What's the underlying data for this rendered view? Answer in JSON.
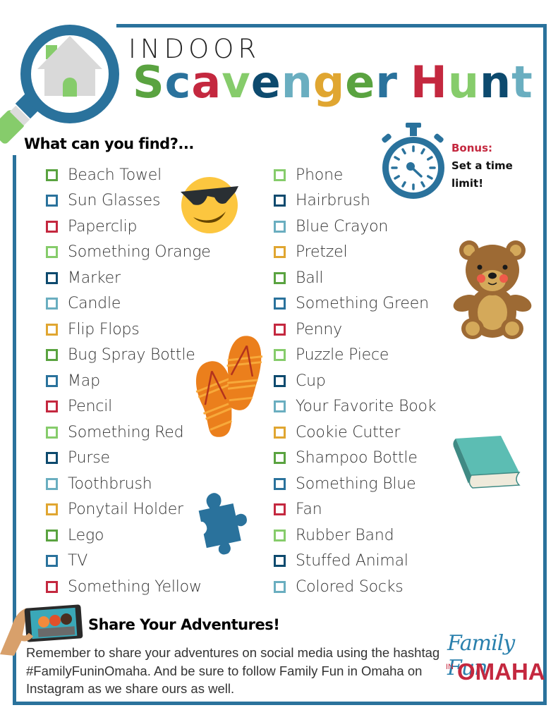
{
  "header": {
    "title_line1": "INDOOR",
    "title_line2_letters": [
      {
        "char": "S",
        "color": "#5aa340"
      },
      {
        "char": "c",
        "color": "#2a729c"
      },
      {
        "char": "a",
        "color": "#c4283f"
      },
      {
        "char": "v",
        "color": "#86cc6b"
      },
      {
        "char": "e",
        "color": "#0d4a6e"
      },
      {
        "char": "n",
        "color": "#6aaec0"
      },
      {
        "char": "g",
        "color": "#e0a631"
      },
      {
        "char": "e",
        "color": "#5aa340"
      },
      {
        "char": "r",
        "color": "#2a729c"
      },
      {
        "char": " ",
        "color": "#000000"
      },
      {
        "char": "H",
        "color": "#c4283f"
      },
      {
        "char": "u",
        "color": "#86cc6b"
      },
      {
        "char": "n",
        "color": "#0d4a6e"
      },
      {
        "char": "t",
        "color": "#6aaec0"
      }
    ],
    "subtitle": "What can you find?..."
  },
  "bonus": {
    "label": "Bonus:",
    "text_line1": "Set a time",
    "text_line2": "limit!"
  },
  "colors": {
    "frame": "#2a729c",
    "green": "#5aa340",
    "blue": "#2a729c",
    "red": "#c4283f",
    "light_green": "#86cc6b",
    "navy": "#0d4a6e",
    "light_blue": "#6aaec0",
    "orange": "#e0a631"
  },
  "checklist": {
    "left": [
      {
        "label": "Beach Towel",
        "color": "#5aa340",
        "checked": false
      },
      {
        "label": "Sun Glasses",
        "color": "#2a729c",
        "checked": false
      },
      {
        "label": "Paperclip",
        "color": "#c4283f",
        "checked": false
      },
      {
        "label": "Something Orange",
        "color": "#86cc6b",
        "checked": false
      },
      {
        "label": "Marker",
        "color": "#0d4a6e",
        "checked": false
      },
      {
        "label": "Candle",
        "color": "#6aaec0",
        "checked": false
      },
      {
        "label": "Flip Flops",
        "color": "#e0a631",
        "checked": false
      },
      {
        "label": "Bug Spray Bottle",
        "color": "#5aa340",
        "checked": false
      },
      {
        "label": "Map",
        "color": "#2a729c",
        "checked": false
      },
      {
        "label": "Pencil",
        "color": "#c4283f",
        "checked": false
      },
      {
        "label": "Something Red",
        "color": "#86cc6b",
        "checked": false
      },
      {
        "label": "Purse",
        "color": "#0d4a6e",
        "checked": false
      },
      {
        "label": "Toothbrush",
        "color": "#6aaec0",
        "checked": false
      },
      {
        "label": "Ponytail Holder",
        "color": "#e0a631",
        "checked": false
      },
      {
        "label": "Lego",
        "color": "#5aa340",
        "checked": false
      },
      {
        "label": "TV",
        "color": "#2a729c",
        "checked": false
      },
      {
        "label": "Something Yellow",
        "color": "#c4283f",
        "checked": false
      }
    ],
    "right": [
      {
        "label": "Phone",
        "color": "#86cc6b",
        "checked": false
      },
      {
        "label": "Hairbrush",
        "color": "#0d4a6e",
        "checked": false
      },
      {
        "label": "Blue Crayon",
        "color": "#6aaec0",
        "checked": false
      },
      {
        "label": "Pretzel",
        "color": "#e0a631",
        "checked": false
      },
      {
        "label": "Ball",
        "color": "#5aa340",
        "checked": false
      },
      {
        "label": "Something Green",
        "color": "#2a729c",
        "checked": false
      },
      {
        "label": "Penny",
        "color": "#c4283f",
        "checked": false
      },
      {
        "label": "Puzzle Piece",
        "color": "#86cc6b",
        "checked": false
      },
      {
        "label": "Cup",
        "color": "#0d4a6e",
        "checked": false
      },
      {
        "label": "Your Favorite Book",
        "color": "#6aaec0",
        "checked": false
      },
      {
        "label": "Cookie Cutter",
        "color": "#e0a631",
        "checked": false
      },
      {
        "label": "Shampoo Bottle",
        "color": "#5aa340",
        "checked": false
      },
      {
        "label": "Something Blue",
        "color": "#2a729c",
        "checked": false
      },
      {
        "label": "Fan",
        "color": "#c4283f",
        "checked": false
      },
      {
        "label": "Rubber Band",
        "color": "#86cc6b",
        "checked": false
      },
      {
        "label": "Stuffed Animal",
        "color": "#0d4a6e",
        "checked": false
      },
      {
        "label": "Colored Socks",
        "color": "#6aaec0",
        "checked": false
      }
    ]
  },
  "illustrations": {
    "magnifier": "magnifying-glass-house-icon",
    "stopwatch": "stopwatch-icon",
    "sunglasses": "sunglasses-emoji-icon",
    "teddy": "teddy-bear-icon",
    "flipflops": "flip-flops-icon",
    "book": "book-icon",
    "puzzle": "puzzle-piece-icon",
    "selfie": "selfie-phone-icon"
  },
  "share": {
    "title": "Share Your Adventures!",
    "body": "Remember to share your adventures on social media using the hashtag #FamilyFuninOmaha. And be sure to follow Family Fun in Omaha on Instagram as we share ours as well."
  },
  "logo": {
    "line1": "Family Fun",
    "prefix": "IN",
    "line2": "OMAHA"
  }
}
